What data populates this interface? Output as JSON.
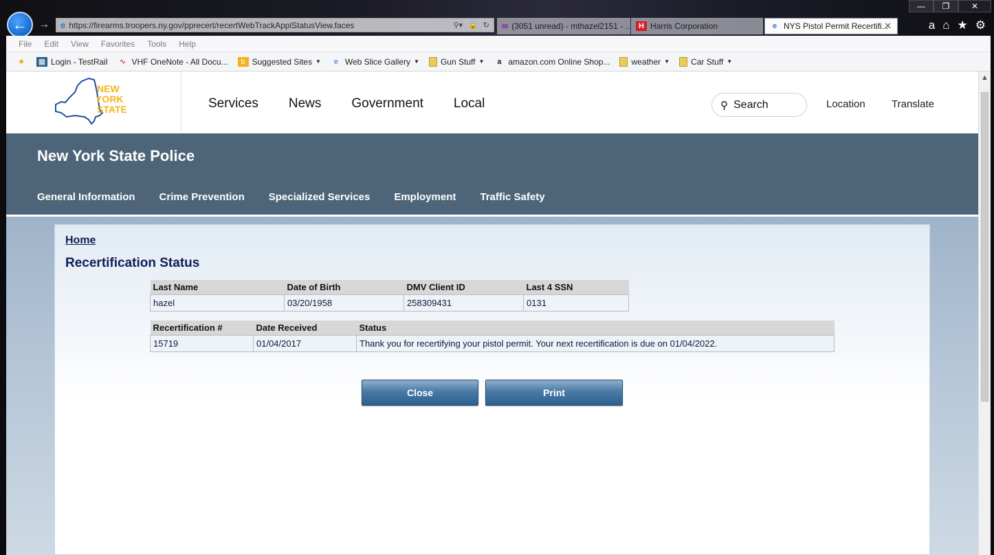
{
  "browser": {
    "address_url": "https://firearms.troopers.ny.gov/pprecert/recertWebTrackApplStatusView.faces",
    "tabs": [
      {
        "label": "(3051 unread) - mthazel2151 - ..."
      },
      {
        "label": "Harris Corporation"
      },
      {
        "label": "NYS Pistol Permit Recertifi..."
      }
    ],
    "menu": [
      "File",
      "Edit",
      "View",
      "Favorites",
      "Tools",
      "Help"
    ],
    "favorites": [
      {
        "label": "Login - TestRail",
        "icon": "testrail-icon"
      },
      {
        "label": "VHF OneNote - All Docu...",
        "icon": "onenote-icon"
      },
      {
        "label": "Suggested Sites",
        "icon": "bing-icon"
      },
      {
        "label": "Web Slice Gallery",
        "icon": "ie-icon"
      },
      {
        "label": "Gun Stuff",
        "icon": "folder-icon"
      },
      {
        "label": "amazon.com Online Shop...",
        "icon": "amazon-icon"
      },
      {
        "label": "weather",
        "icon": "folder-icon"
      },
      {
        "label": "Car Stuff",
        "icon": "folder-icon"
      }
    ]
  },
  "site": {
    "logo_text": [
      "NEW",
      "YORK",
      "STATE"
    ],
    "nav": [
      "Services",
      "News",
      "Government",
      "Local"
    ],
    "search_label": "Search",
    "location_label": "Location",
    "translate_label": "Translate",
    "agency_title": "New York State Police",
    "agency_nav": [
      "General Information",
      "Crime Prevention",
      "Specialized Services",
      "Employment",
      "Traffic Safety"
    ]
  },
  "content": {
    "breadcrumb": "Home",
    "title": "Recertification Status",
    "id_table": {
      "headers": [
        "Last Name",
        "Date of Birth",
        "DMV Client ID",
        "Last 4 SSN"
      ],
      "row": [
        "hazel",
        "03/20/1958",
        "258309431",
        "0131"
      ]
    },
    "status_table": {
      "headers": [
        "Recertification #",
        "Date Received",
        "Status"
      ],
      "row": [
        "15719",
        "01/04/2017",
        "Thank you for recertifying your pistol permit. Your next recertification is due on 01/04/2022."
      ]
    },
    "close_label": "Close",
    "print_label": "Print"
  },
  "colors": {
    "agency_bar": "#4e6579",
    "title_text": "#0d1e5a",
    "logo_gold": "#f2b51c",
    "logo_blue": "#1f4f9e"
  }
}
